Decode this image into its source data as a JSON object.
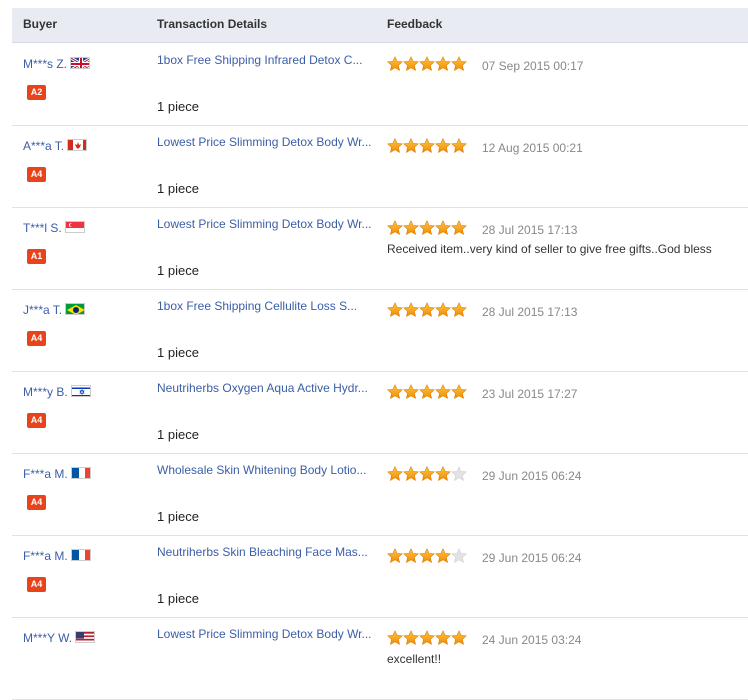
{
  "header": {
    "buyer": "Buyer",
    "details": "Transaction Details",
    "feedback": "Feedback"
  },
  "rows": [
    {
      "buyer": "M***s Z.",
      "flag": "uk-flag-icon",
      "badge": "A2",
      "product": "1box Free Shipping Infrared Detox C...",
      "quantity": "1 piece",
      "rating": 5,
      "date": "07 Sep 2015 00:17",
      "comment": ""
    },
    {
      "buyer": "A***a T.",
      "flag": "canada-flag-icon",
      "badge": "A4",
      "product": "Lowest Price Slimming Detox Body Wr...",
      "quantity": "1 piece",
      "rating": 5,
      "date": "12 Aug 2015 00:21",
      "comment": ""
    },
    {
      "buyer": "T***l S.",
      "flag": "singapore-flag-icon",
      "badge": "A1",
      "product": "Lowest Price Slimming Detox Body Wr...",
      "quantity": "1 piece",
      "rating": 5,
      "date": "28 Jul 2015 17:13",
      "comment": "Received item..very kind of seller to give free gifts..God bless"
    },
    {
      "buyer": "J***a T.",
      "flag": "brazil-flag-icon",
      "badge": "A4",
      "product": "1box Free Shipping Cellulite Loss S...",
      "quantity": "1 piece",
      "rating": 5,
      "date": "28 Jul 2015 17:13",
      "comment": ""
    },
    {
      "buyer": "M***y B.",
      "flag": "israel-flag-icon",
      "badge": "A4",
      "product": "Neutriherbs Oxygen Aqua Active Hydr...",
      "quantity": "1 piece",
      "rating": 5,
      "date": "23 Jul 2015 17:27",
      "comment": ""
    },
    {
      "buyer": "F***a M.",
      "flag": "france-flag-icon",
      "badge": "A4",
      "product": "Wholesale Skin Whitening Body Lotio...",
      "quantity": "1 piece",
      "rating": 4,
      "date": "29 Jun 2015 06:24",
      "comment": ""
    },
    {
      "buyer": "F***a M.",
      "flag": "france-flag-icon",
      "badge": "A4",
      "product": "Neutriherbs Skin Bleaching Face Mas...",
      "quantity": "1 piece",
      "rating": 4,
      "date": "29 Jun 2015 06:24",
      "comment": ""
    },
    {
      "buyer": "M***Y W.",
      "flag": "usa-flag-icon",
      "badge": "",
      "product": "Lowest Price Slimming Detox Body Wr...",
      "quantity": "",
      "rating": 5,
      "date": "24 Jun 2015 03:24",
      "comment": "excellent!!"
    }
  ]
}
